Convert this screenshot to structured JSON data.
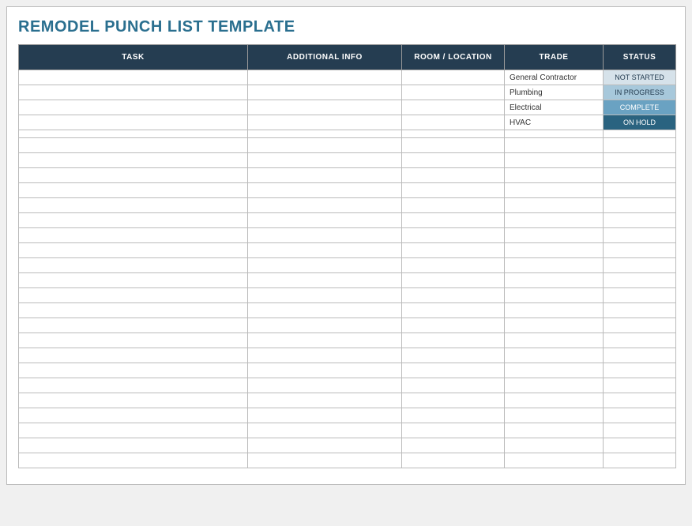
{
  "title": "REMODEL PUNCH LIST TEMPLATE",
  "headers": {
    "task": "TASK",
    "info": "ADDITIONAL INFO",
    "room": "ROOM / LOCATION",
    "trade": "TRADE",
    "status": "STATUS"
  },
  "rows": [
    {
      "task": "",
      "info": "",
      "room": "",
      "trade": "General Contractor",
      "status": "NOT STARTED",
      "status_bg": "#d6e2ea",
      "status_fg": "#253d51"
    },
    {
      "task": "",
      "info": "",
      "room": "",
      "trade": "Plumbing",
      "status": "IN PROGRESS",
      "status_bg": "#a7c8db",
      "status_fg": "#253d51"
    },
    {
      "task": "",
      "info": "",
      "room": "",
      "trade": "Electrical",
      "status": "COMPLETE",
      "status_bg": "#6aa2c2",
      "status_fg": "#ffffff"
    },
    {
      "task": "",
      "info": "",
      "room": "",
      "trade": "HVAC",
      "status": "ON HOLD",
      "status_bg": "#2a6380",
      "status_fg": "#ffffff"
    }
  ],
  "empty_row_count": 22
}
